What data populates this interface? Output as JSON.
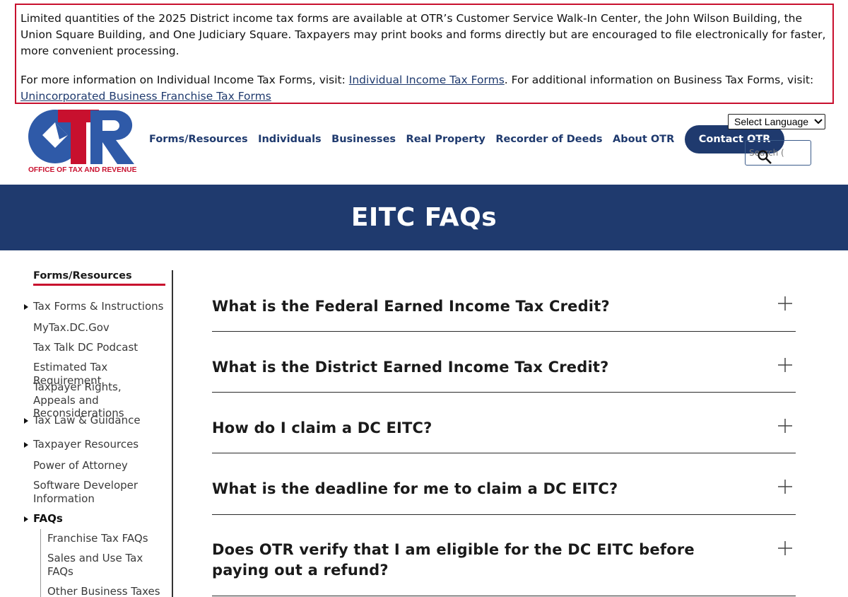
{
  "alert": {
    "p1": "Limited quantities of the 2025 District income tax forms are available at OTR’s Customer Service Walk-In Center, the John Wilson Building, the Union Square Building, and One Judiciary Square. Taxpayers may print books and forms directly but are encouraged to file electronically for faster, more convenient processing.",
    "p2_prefix": "For more information on Individual Income Tax Forms, visit: ",
    "p2_link1": "Individual Income Tax Forms",
    "p2_mid": ". For additional information on Business Tax Forms, visit: ",
    "p2_link2": "Unincorporated Business Franchise Tax Forms"
  },
  "logo": {
    "letters": "OTR",
    "tagline": "OFFICE OF TAX AND REVENUE",
    "colors": {
      "blue": "#2f5aa8",
      "red": "#c8102e"
    }
  },
  "nav": {
    "items": [
      "Forms/Resources",
      "Individuals",
      "Businesses",
      "Real Property",
      "Recorder of Deeds",
      "About OTR"
    ],
    "contact": "Contact OTR"
  },
  "language": {
    "selected": "Select Language"
  },
  "search": {
    "placeholder": "Search ("
  },
  "hero": {
    "title": "EITC FAQs"
  },
  "sidebar": {
    "title": "Forms/Resources",
    "items": [
      {
        "label": "Tax Forms & Instructions",
        "expandable": true
      },
      {
        "label": "MyTax.DC.Gov",
        "expandable": false
      },
      {
        "label": "Tax Talk DC Podcast",
        "expandable": false
      },
      {
        "label": "Estimated Tax Requirement",
        "expandable": false
      },
      {
        "label": "Taxpayer Rights, Appeals and Reconsiderations",
        "expandable": false
      },
      {
        "label": "Tax Law & Guidance",
        "expandable": true
      },
      {
        "label": "Taxpayer Resources",
        "expandable": true
      },
      {
        "label": "Power of Attorney",
        "expandable": false
      },
      {
        "label": "Software Developer Information",
        "expandable": false
      },
      {
        "label": "FAQs",
        "expandable": true,
        "active": true
      }
    ],
    "subitems": [
      "Franchise Tax FAQs",
      "Sales and Use Tax FAQs",
      "Other Business Taxes"
    ]
  },
  "faqs": [
    "What is the Federal Earned Income Tax Credit?",
    "What is the District Earned Income Tax Credit?",
    "How do I claim a DC EITC?",
    "What is the deadline for me to claim a DC EITC?",
    "Does OTR verify that I am eligible for the DC EITC before paying out a refund?"
  ],
  "colors": {
    "navy": "#1f3a6e",
    "accent_red": "#c8102e"
  }
}
